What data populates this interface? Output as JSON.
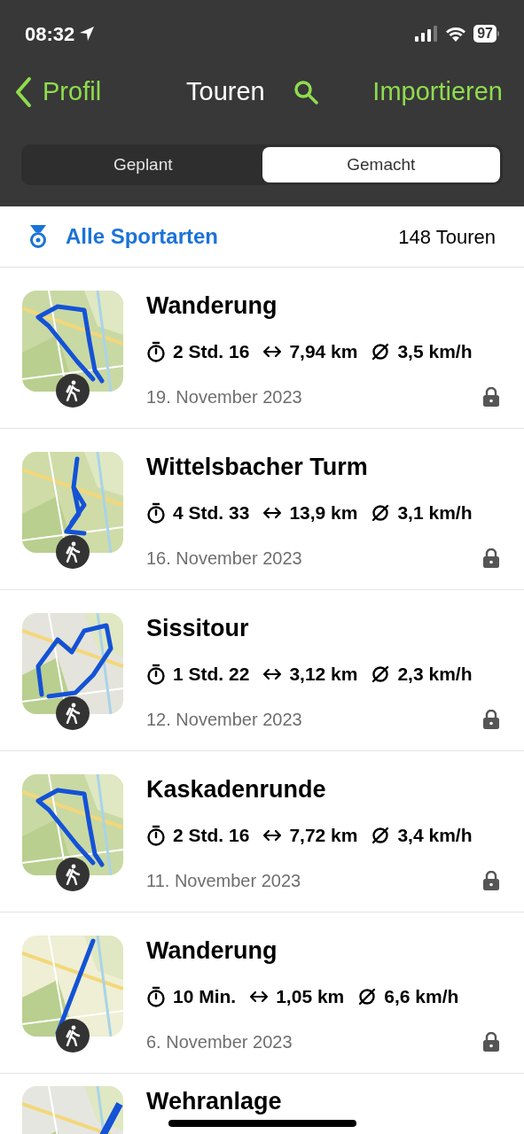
{
  "status_bar": {
    "time": "08:32",
    "battery": "97"
  },
  "nav": {
    "back": "Profil",
    "title": "Touren",
    "action": "Importieren"
  },
  "segments": [
    {
      "label": "Geplant",
      "selected": false
    },
    {
      "label": "Gemacht",
      "selected": true
    }
  ],
  "filter": {
    "label": "Alle Sportarten",
    "count": "148 Touren"
  },
  "tours": [
    {
      "title": "Wanderung",
      "duration": "2 Std. 16",
      "distance": "7,94 km",
      "speed": "3,5 km/h",
      "date": "19. November 2023"
    },
    {
      "title": "Wittelsbacher Turm",
      "duration": "4 Std. 33",
      "distance": "13,9 km",
      "speed": "3,1 km/h",
      "date": "16. November 2023"
    },
    {
      "title": "Sissitour",
      "duration": "1 Std. 22",
      "distance": "3,12 km",
      "speed": "2,3 km/h",
      "date": "12. November 2023"
    },
    {
      "title": "Kaskadenrunde",
      "duration": "2 Std. 16",
      "distance": "7,72 km",
      "speed": "3,4 km/h",
      "date": "11. November 2023"
    },
    {
      "title": "Wanderung",
      "duration": "10 Min.",
      "distance": "1,05 km",
      "speed": "6,6 km/h",
      "date": "6. November 2023"
    },
    {
      "title": "Wehranlage"
    }
  ]
}
